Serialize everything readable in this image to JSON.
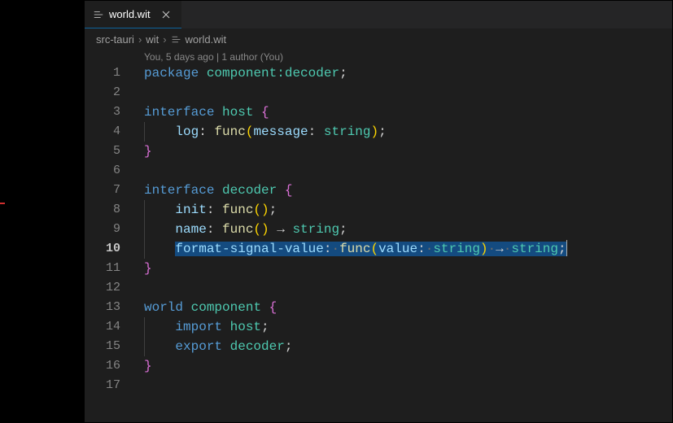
{
  "tab": {
    "filename": "world.wit"
  },
  "breadcrumbs": [
    "src-tauri",
    "wit",
    "world.wit"
  ],
  "codelens": "You, 5 days ago | 1 author (You)",
  "lines": 17,
  "current_line": 10,
  "code": {
    "l1": {
      "kw": "package",
      "name": "component:decoder",
      "semi": ";"
    },
    "l3": {
      "kw": "interface",
      "name": "host",
      "brace": "{"
    },
    "l4": {
      "prop": "log",
      "colon": ": ",
      "fn": "func",
      "lp": "(",
      "param": "message",
      "pcolon": ": ",
      "ptype": "string",
      "rp": ")",
      "semi": ";"
    },
    "l5": {
      "brace": "}"
    },
    "l7": {
      "kw": "interface",
      "name": "decoder",
      "brace": "{"
    },
    "l8": {
      "prop": "init",
      "colon": ": ",
      "fn": "func",
      "parens": "()",
      "semi": ";"
    },
    "l9": {
      "prop": "name",
      "colon": ": ",
      "fn": "func",
      "parens": "()",
      "arrow": " → ",
      "ret": "string",
      "semi": ";"
    },
    "l10": {
      "prop": "format-signal-value",
      "colon": ":",
      "d1": "·",
      "fn": "func",
      "lp": "(",
      "param": "value",
      "pcolon": ":",
      "d2": "·",
      "ptype": "string",
      "rp": ")",
      "d3": "·",
      "arrow": "→",
      "d4": "·",
      "ret": "string",
      "semi": ";"
    },
    "l11": {
      "brace": "}"
    },
    "l13": {
      "kw": "world",
      "name": "component",
      "brace": "{"
    },
    "l14": {
      "kw": "import",
      "name": "host",
      "semi": ";"
    },
    "l15": {
      "kw": "export",
      "name": "decoder",
      "semi": ";"
    },
    "l16": {
      "brace": "}"
    }
  }
}
